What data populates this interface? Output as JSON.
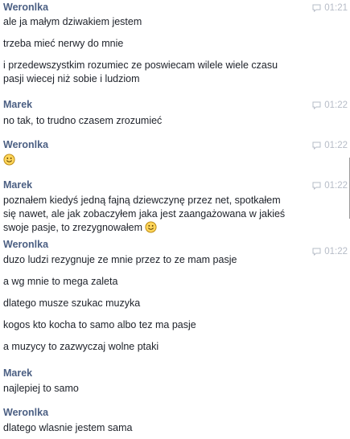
{
  "conversation": {
    "groups": [
      {
        "sender": "Weronlka",
        "time": "01:21",
        "lines": [
          "ale ja małym dziwakiem jestem",
          "trzeba mieć nerwy do mnie",
          "i przedewszystkim rozumiec ze poswiecam wilele wiele czasu",
          "pasji wiecej niż sobie i ludziom"
        ]
      },
      {
        "sender": "Marek",
        "time": "01:22",
        "lines": [
          "no tak, to trudno czasem zrozumieć"
        ]
      },
      {
        "sender": "Weronlka",
        "time": "01:22",
        "emoji": "smile-emoji"
      },
      {
        "sender": "Marek",
        "time": "01:22",
        "lines": [
          "poznałem kiedyś jedną fajną dziewczynę przez net, spotkałem",
          "się nawet, ale jak zobaczyłem jaka jest zaangażowana w jakieś",
          "swoje pasje, to zrezygnowałem"
        ],
        "emoji": "smile-emoji"
      },
      {
        "sender": "Weronlka",
        "time": "01:22",
        "lines": [
          "duzo ludzi rezygnuje ze mnie przez to ze mam pasje",
          "a wg mnie to mega zaleta",
          "dlatego musze szukac muzyka",
          "kogos kto kocha to samo albo tez ma pasje",
          "a muzycy to zazwyczaj wolne ptaki"
        ]
      },
      {
        "sender": "Marek",
        "lines": [
          "najlepiej to samo"
        ]
      },
      {
        "sender": "Weronlka",
        "lines": [
          "dlatego wlasnie jestem sama"
        ]
      }
    ]
  },
  "colors": {
    "sender": "#4b5f83",
    "text": "#1d2129",
    "time": "#b6bcc7",
    "emoji_fill": "#ffd65b",
    "emoji_stroke": "#b8860b"
  },
  "icons": {
    "timestamp_icon": "chat-bubble-icon",
    "emoji": "smile-emoji"
  }
}
